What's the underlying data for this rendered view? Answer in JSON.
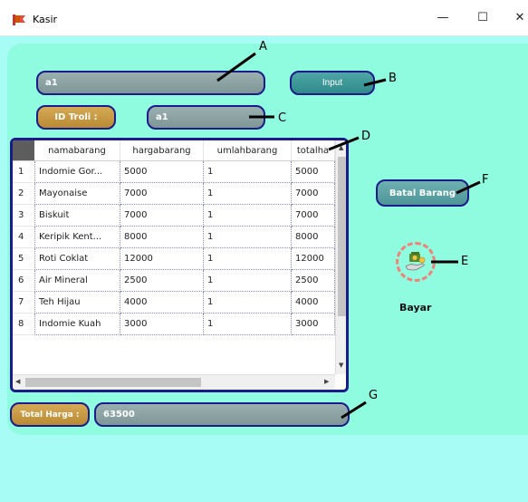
{
  "window": {
    "title": "Kasir",
    "minimize": "—",
    "maximize": "☐",
    "close": "✕"
  },
  "form": {
    "field_a_value": "a1",
    "input_button": "Input",
    "id_troli_label": "ID Troli :",
    "id_troli_value": "a1",
    "batal_button": "Batal Barang",
    "bayar_label": "Bayar",
    "total_label": "Total Harga :",
    "total_value": "63500"
  },
  "table": {
    "columns": [
      "namabarang",
      "hargabarang",
      "umlahbarang",
      "totalha"
    ],
    "rows": [
      {
        "num": "1",
        "namabarang": "Indomie Gor...",
        "hargabarang": "5000",
        "jumlah": "1",
        "total": "5000"
      },
      {
        "num": "2",
        "namabarang": "Mayonaise",
        "hargabarang": "7000",
        "jumlah": "1",
        "total": "7000"
      },
      {
        "num": "3",
        "namabarang": "Biskuit",
        "hargabarang": "7000",
        "jumlah": "1",
        "total": "7000"
      },
      {
        "num": "4",
        "namabarang": "Keripik Kent...",
        "hargabarang": "8000",
        "jumlah": "1",
        "total": "8000"
      },
      {
        "num": "5",
        "namabarang": "Roti Coklat",
        "hargabarang": "12000",
        "jumlah": "1",
        "total": "12000"
      },
      {
        "num": "6",
        "namabarang": "Air Mineral",
        "hargabarang": "2500",
        "jumlah": "1",
        "total": "2500"
      },
      {
        "num": "7",
        "namabarang": "Teh Hijau",
        "hargabarang": "4000",
        "jumlah": "1",
        "total": "4000"
      },
      {
        "num": "8",
        "namabarang": "Indomie Kuah",
        "hargabarang": "3000",
        "jumlah": "1",
        "total": "3000"
      }
    ]
  },
  "annotations": {
    "a": "A",
    "b": "B",
    "c": "C",
    "d": "D",
    "e": "E",
    "f": "F",
    "g": "G"
  },
  "colors": {
    "background": "#a8fcf6",
    "panel": "#8ffce0",
    "border": "#1d1a8a",
    "orange": "#c99a44",
    "bayar_ring": "#f0827a"
  },
  "icons": {
    "app": "flag-icon",
    "bayar": "money-hand-icon"
  }
}
